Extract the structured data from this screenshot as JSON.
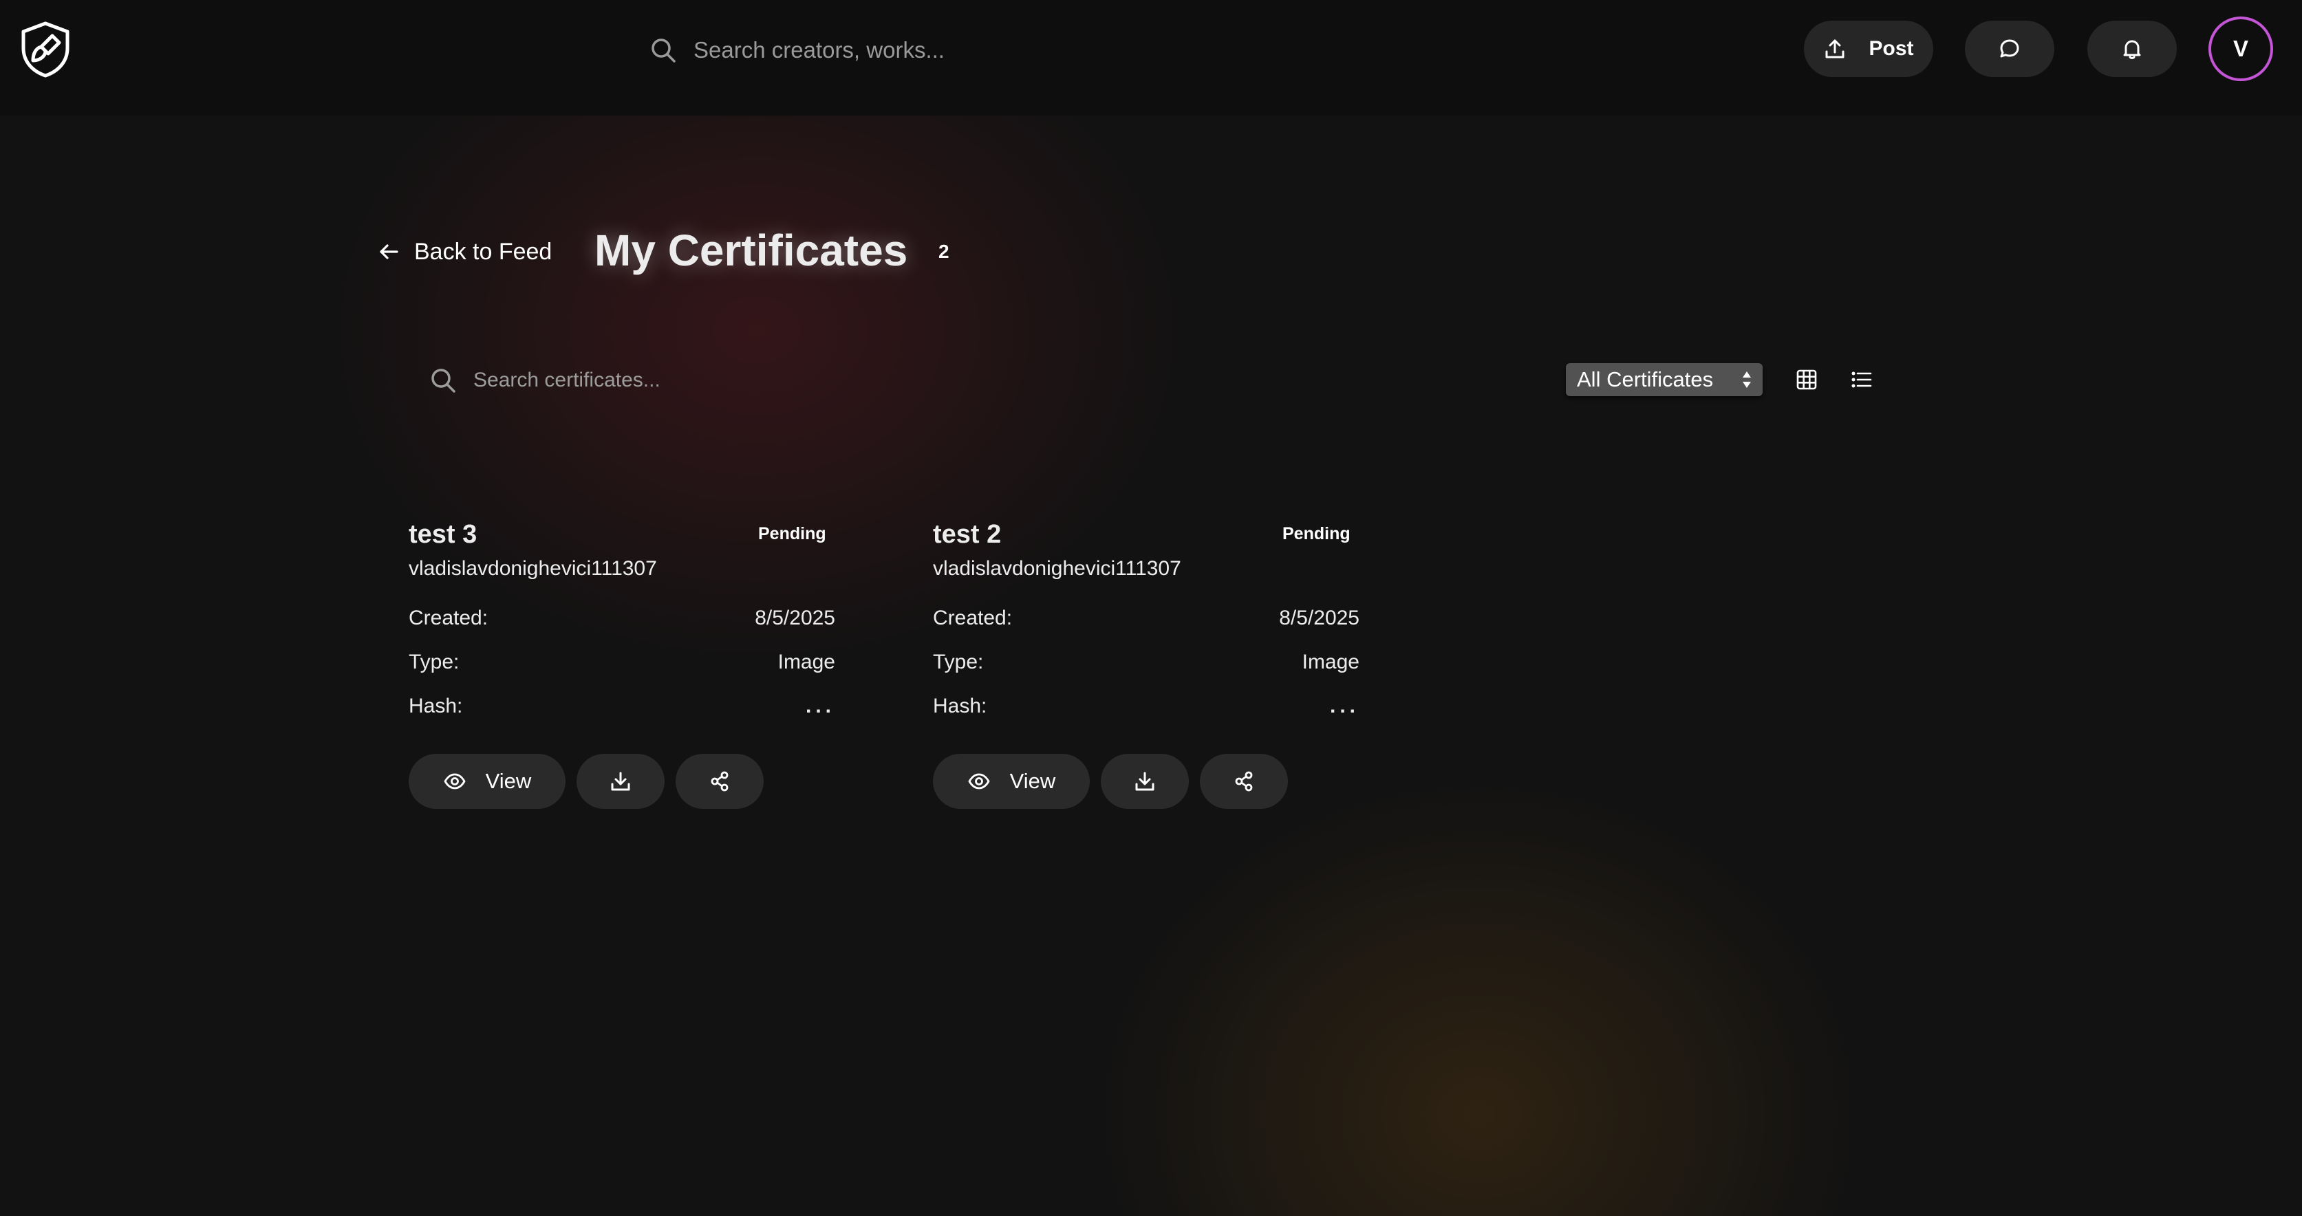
{
  "topbar": {
    "logo_icon": "shield-brush-icon",
    "search_placeholder": "Search creators, works...",
    "post_label": "Post",
    "avatar_initial": "V",
    "avatar_ring_color": "#c455d6"
  },
  "header": {
    "back_label": "Back to Feed",
    "title": "My Certificates",
    "count": "2"
  },
  "filters": {
    "search_placeholder": "Search certificates...",
    "selected_filter": "All Certificates"
  },
  "certificates": [
    {
      "title": "test 3",
      "status": "Pending",
      "owner": "vladislavdonighevici111307",
      "created_label": "Created:",
      "created_value": "8/5/2025",
      "type_label": "Type:",
      "type_value": "Image",
      "hash_label": "Hash:",
      "hash_value": "...",
      "view_label": "View"
    },
    {
      "title": "test 2",
      "status": "Pending",
      "owner": "vladislavdonighevici111307",
      "created_label": "Created:",
      "created_value": "8/5/2025",
      "type_label": "Type:",
      "type_value": "Image",
      "hash_label": "Hash:",
      "hash_value": "...",
      "view_label": "View"
    }
  ]
}
